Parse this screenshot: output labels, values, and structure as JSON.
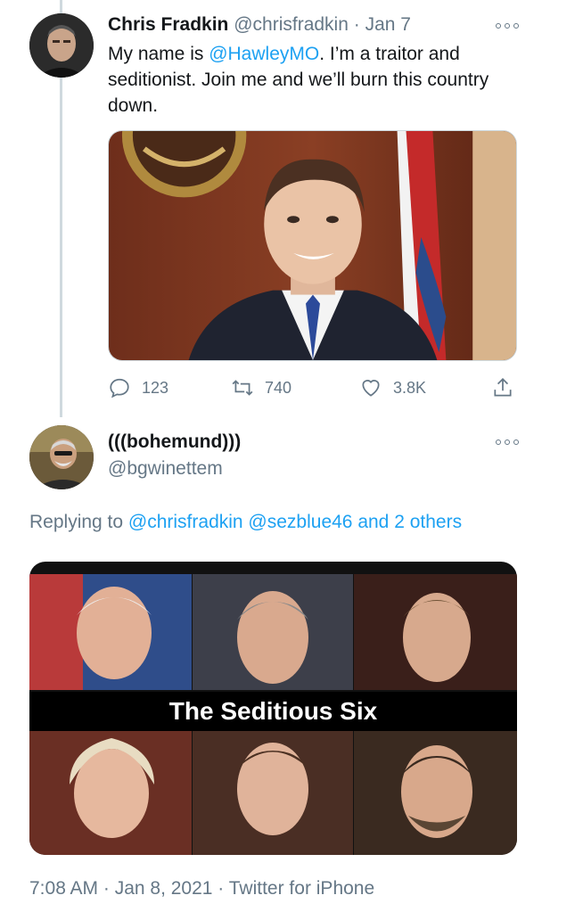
{
  "tweet1": {
    "display_name": "Chris Fradkin",
    "handle": "@chrisfradkin",
    "separator": "·",
    "date": "Jan 7",
    "text_before": "My name is ",
    "mention": "@HawleyMO",
    "text_after": ". I’m a traitor and seditionist. Join me and we’ll burn this country down.",
    "actions": {
      "reply_count": "123",
      "retweet_count": "740",
      "like_count": "3.8K"
    }
  },
  "tweet2": {
    "display_name": "(((bohemund)))",
    "handle": "@bgwinettem",
    "replying_prefix": "Replying to ",
    "replying_to": "@chrisfradkin @sezblue46 and 2 others",
    "media_caption": "The Seditious Six",
    "meta": "7:08 AM · Jan 8, 2021 · Twitter for iPhone"
  },
  "icons": {
    "reply": "reply-icon",
    "retweet": "retweet-icon",
    "like": "heart-icon",
    "share": "share-icon",
    "more": "more-icon"
  },
  "colors": {
    "link": "#1da1f2",
    "muted": "#657786",
    "thread_line": "#cfd9de"
  }
}
